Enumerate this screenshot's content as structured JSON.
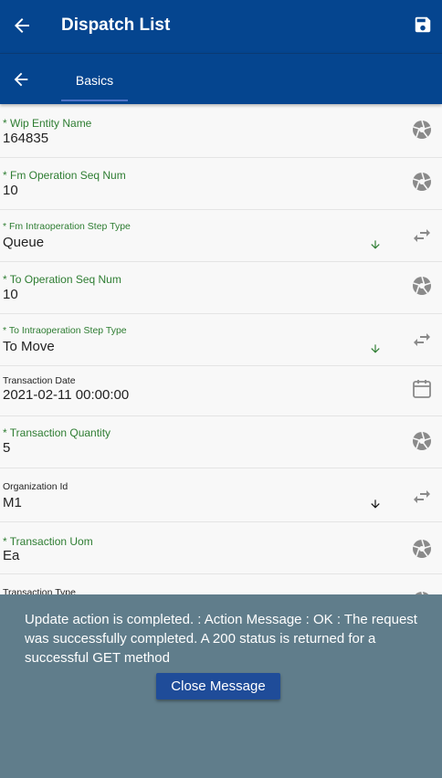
{
  "header": {
    "title": "Dispatch List"
  },
  "tabs": [
    {
      "label": "Basics"
    }
  ],
  "fields": [
    {
      "label": "* Wip Entity Name",
      "value": "164835"
    },
    {
      "label": "* Fm Operation Seq Num",
      "value": "10"
    },
    {
      "label": "* Fm Intraoperation Step Type",
      "value": "Queue"
    },
    {
      "label": "* To Operation Seq Num",
      "value": "10"
    },
    {
      "label": "* To Intraoperation Step Type",
      "value": "To Move"
    },
    {
      "label": "Transaction Date",
      "value": "2021-02-11 00:00:00"
    },
    {
      "label": "* Transaction Quantity",
      "value": "5"
    },
    {
      "label": "Organization Id",
      "value": "M1"
    },
    {
      "label": "* Transaction Uom",
      "value": "Ea"
    },
    {
      "label": "Transaction Type",
      "value": ""
    }
  ],
  "message": {
    "text": "Update action is completed.  : Action Message : OK : The request was successfully completed. A 200 status is returned for a successful GET method",
    "close_label": "Close Message"
  },
  "colors": {
    "primary": "#05458f",
    "required_label": "#2e7d32",
    "dropdown_green": "#2e7d32",
    "overlay": "#607d8b",
    "close_button": "#1f4c99"
  },
  "icons": [
    "back-arrow-icon",
    "save-icon",
    "aperture-icon",
    "swap-icon",
    "dropdown-arrow-icon",
    "calendar-icon"
  ]
}
